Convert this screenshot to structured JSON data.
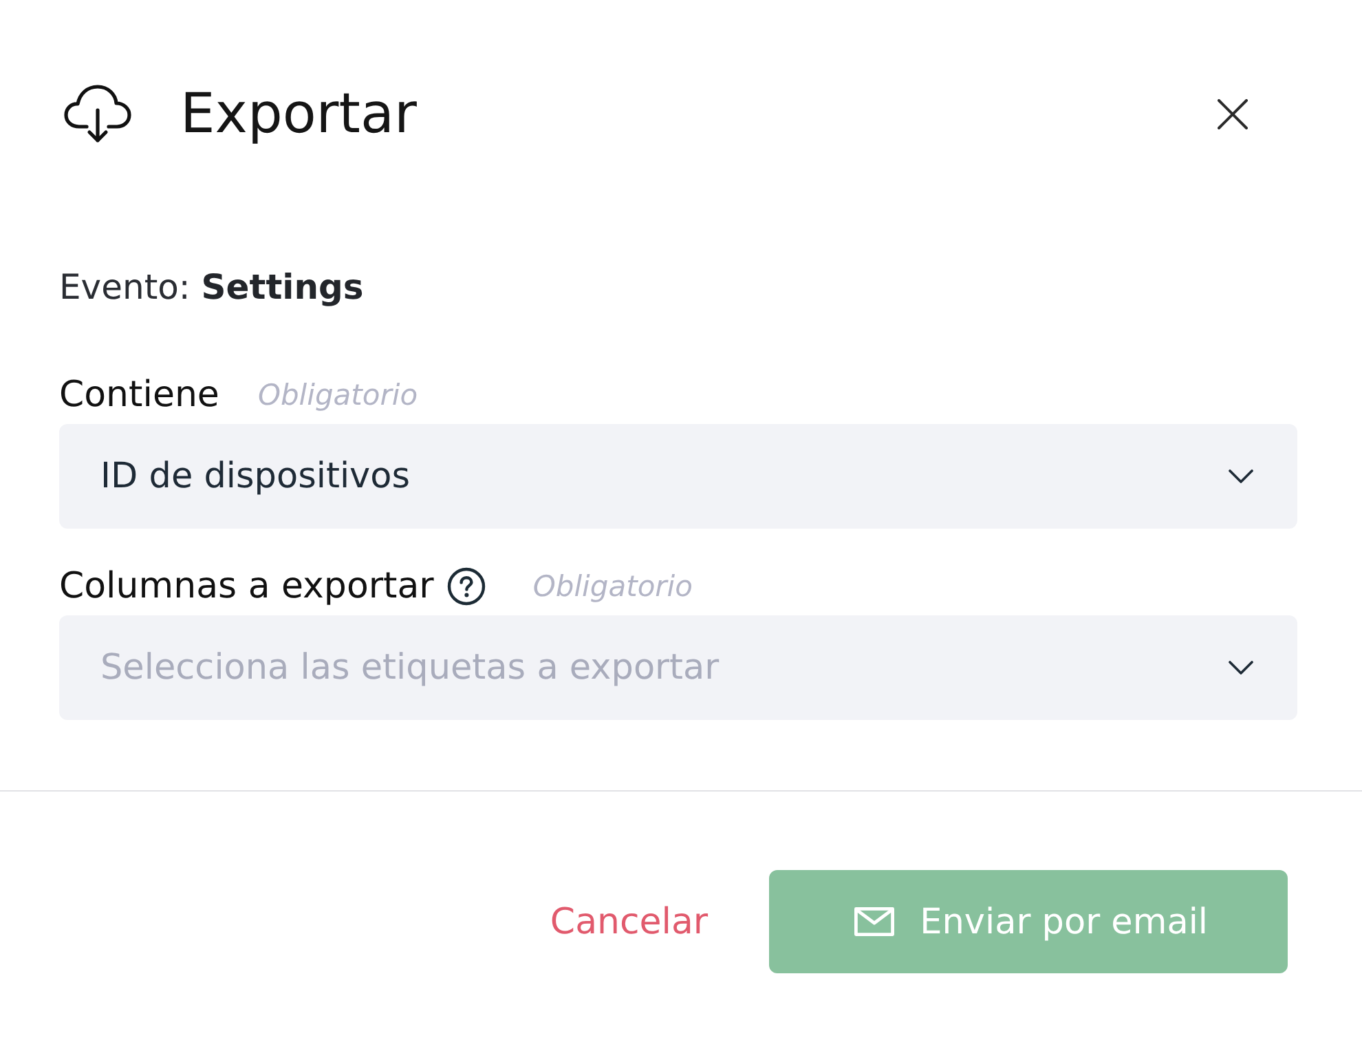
{
  "dialog": {
    "title": "Exportar"
  },
  "event": {
    "text": "Evento: **Settings**"
  },
  "fields": [
    {
      "label": "Contiene",
      "has_help": false,
      "required_note": "Obligatorio",
      "value": "ID de dispositivos"
    },
    {
      "label": "Columnas a exportar",
      "has_help": true,
      "required_note": "Obligatorio",
      "placeholder": "Selecciona las etiquetas a exportar"
    }
  ],
  "buttons": [
    {
      "kind": "link",
      "label": "Cancelar",
      "disabled": false
    },
    {
      "kind": "primary",
      "label": "Enviar por email",
      "disabled": true
    }
  ]
}
